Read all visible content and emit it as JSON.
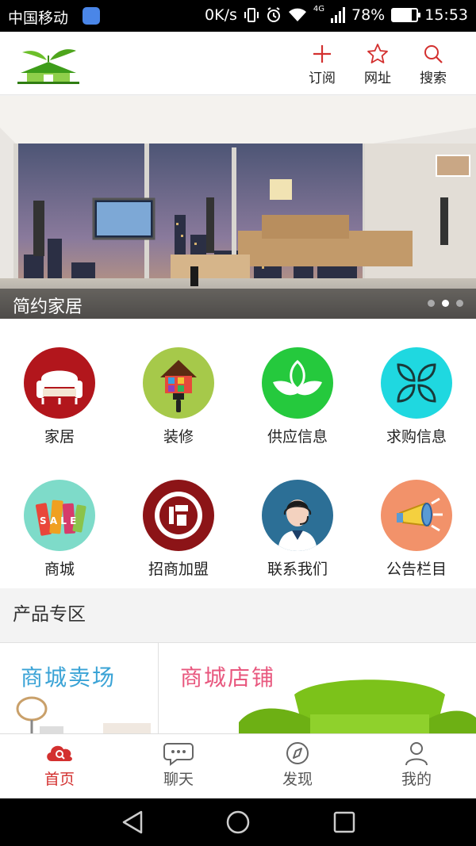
{
  "status_bar": {
    "carrier": "中国移动",
    "speed": "0K/s",
    "network": "4G",
    "battery": "78%",
    "battery_level": 0.78,
    "time": "15:53"
  },
  "header": {
    "logo_icon": "house-leaf-logo",
    "actions": [
      {
        "label": "订阅",
        "icon": "plus-icon"
      },
      {
        "label": "网址",
        "icon": "star-icon"
      },
      {
        "label": "搜索",
        "icon": "search-icon"
      }
    ]
  },
  "banner": {
    "caption": "简约家居",
    "page_count": 3,
    "active_page": 2
  },
  "grid": {
    "items": [
      {
        "label": "家居",
        "icon": "sofa-icon",
        "color": "#b2161c"
      },
      {
        "label": "装修",
        "icon": "paint-brush-icon",
        "color": "#a6c94a"
      },
      {
        "label": "供应信息",
        "icon": "leaf-icon",
        "color": "#25c93d"
      },
      {
        "label": "求购信息",
        "icon": "petals-icon",
        "color": "#1fd8e0"
      },
      {
        "label": "商城",
        "icon": "sale-tags-icon",
        "color": "#7edbc9"
      },
      {
        "label": "招商加盟",
        "icon": "zhao-badge-icon",
        "color": "#8c1417"
      },
      {
        "label": "联系我们",
        "icon": "customer-service-icon",
        "color": "#2c6f96"
      },
      {
        "label": "公告栏目",
        "icon": "megaphone-icon",
        "color": "#f2926a"
      }
    ]
  },
  "products": {
    "section_title": "产品专区",
    "cards": [
      {
        "title": "商城卖场",
        "color": "#3aa3d6"
      },
      {
        "title": "商城店铺",
        "color": "#e8577e"
      }
    ]
  },
  "tabbar": {
    "tabs": [
      {
        "label": "首页",
        "icon": "cloud-search-icon",
        "active": true
      },
      {
        "label": "聊天",
        "icon": "chat-bubble-icon",
        "active": false
      },
      {
        "label": "发现",
        "icon": "compass-icon",
        "active": false
      },
      {
        "label": "我的",
        "icon": "user-icon",
        "active": false
      }
    ]
  },
  "colors": {
    "accent": "#d3302f"
  }
}
